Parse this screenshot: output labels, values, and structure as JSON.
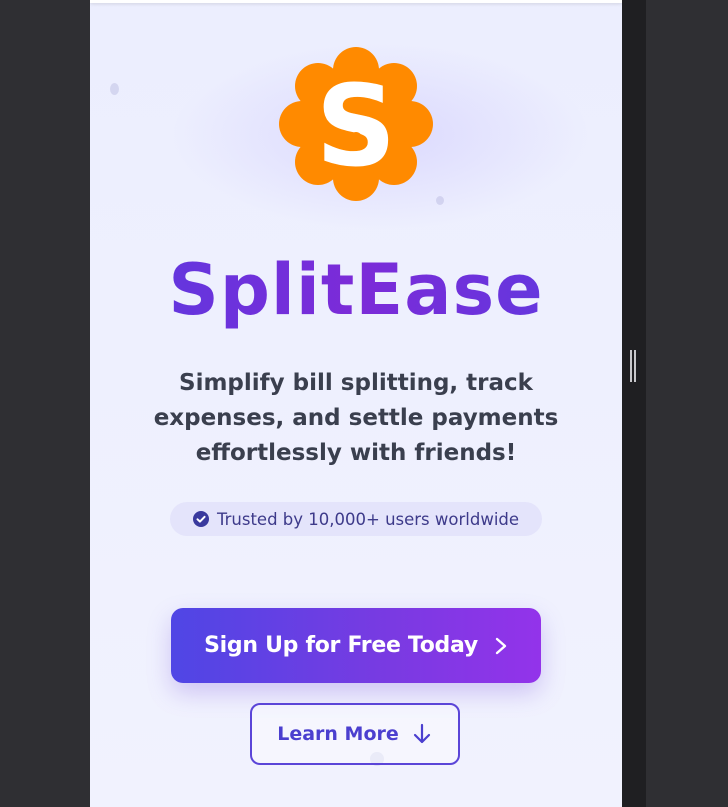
{
  "app": {
    "title_part1": "Split",
    "title_part2": "Ease",
    "logo_letter": "S"
  },
  "hero": {
    "tagline": "Simplify bill splitting, track expenses, and settle payments effortlessly with friends!",
    "trust_text": "Trusted by 10,000+ users worldwide"
  },
  "actions": {
    "signup_label": "Sign Up for Free Today",
    "learn_more_label": "Learn More"
  },
  "icons": {
    "logo": "splitease-logo-icon",
    "badge": "check-circle-icon",
    "signup": "chevron-right-icon",
    "learn_more": "arrow-down-icon"
  },
  "colors": {
    "logo_orange": "#ff8a00",
    "brand_purple": "#5a3ae0",
    "button_gradient_start": "#4f46e5",
    "button_gradient_end": "#9333ea",
    "text_dark": "#3a3f4e"
  }
}
